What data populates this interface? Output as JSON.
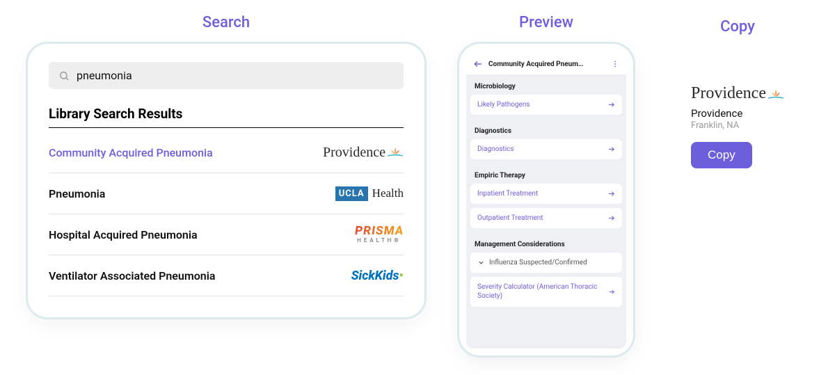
{
  "colors": {
    "accent": "#6d5edb"
  },
  "columns": {
    "search_title": "Search",
    "preview_title": "Preview",
    "copy_title": "Copy"
  },
  "search": {
    "query": "pneumonia",
    "results_header": "Library Search Results",
    "results": [
      {
        "title": "Community Acquired Pneumonia",
        "org": "Providence",
        "logo": "providence",
        "active": true
      },
      {
        "title": "Pneumonia",
        "org": "UCLA Health",
        "logo": "ucla",
        "active": false
      },
      {
        "title": "Hospital Acquired Pneumonia",
        "org": "Prisma Health",
        "logo": "prisma",
        "active": false
      },
      {
        "title": "Ventilator Associated Pneumonia",
        "org": "SickKids",
        "logo": "sickkids",
        "active": false
      }
    ]
  },
  "preview": {
    "title": "Community Acquired Pneum…",
    "sections": [
      {
        "label": "Microbiology",
        "items": [
          {
            "label": "Likely Pathogens",
            "kind": "link"
          }
        ]
      },
      {
        "label": "Diagnostics",
        "items": [
          {
            "label": "Diagnostics",
            "kind": "link"
          }
        ]
      },
      {
        "label": "Empiric Therapy",
        "items": [
          {
            "label": "Inpatient Treatment",
            "kind": "link"
          },
          {
            "label": "Outpatient Treatment",
            "kind": "link"
          }
        ]
      },
      {
        "label": "Management Considerations",
        "items": [
          {
            "label": "Influenza Suspected/Confirmed",
            "kind": "expand"
          },
          {
            "label": "Severity Calculator (American Thoracic Society)",
            "kind": "link"
          }
        ]
      }
    ]
  },
  "copy": {
    "org": "Providence",
    "location": "Franklin, NA",
    "button": "Copy"
  },
  "logo_text": {
    "providence": "Providence",
    "ucla_box": "UCLA",
    "ucla_text": "Health",
    "prisma_top": "PRISMA",
    "prisma_bot": "HEALTH®",
    "sickkids": "SickKids"
  }
}
